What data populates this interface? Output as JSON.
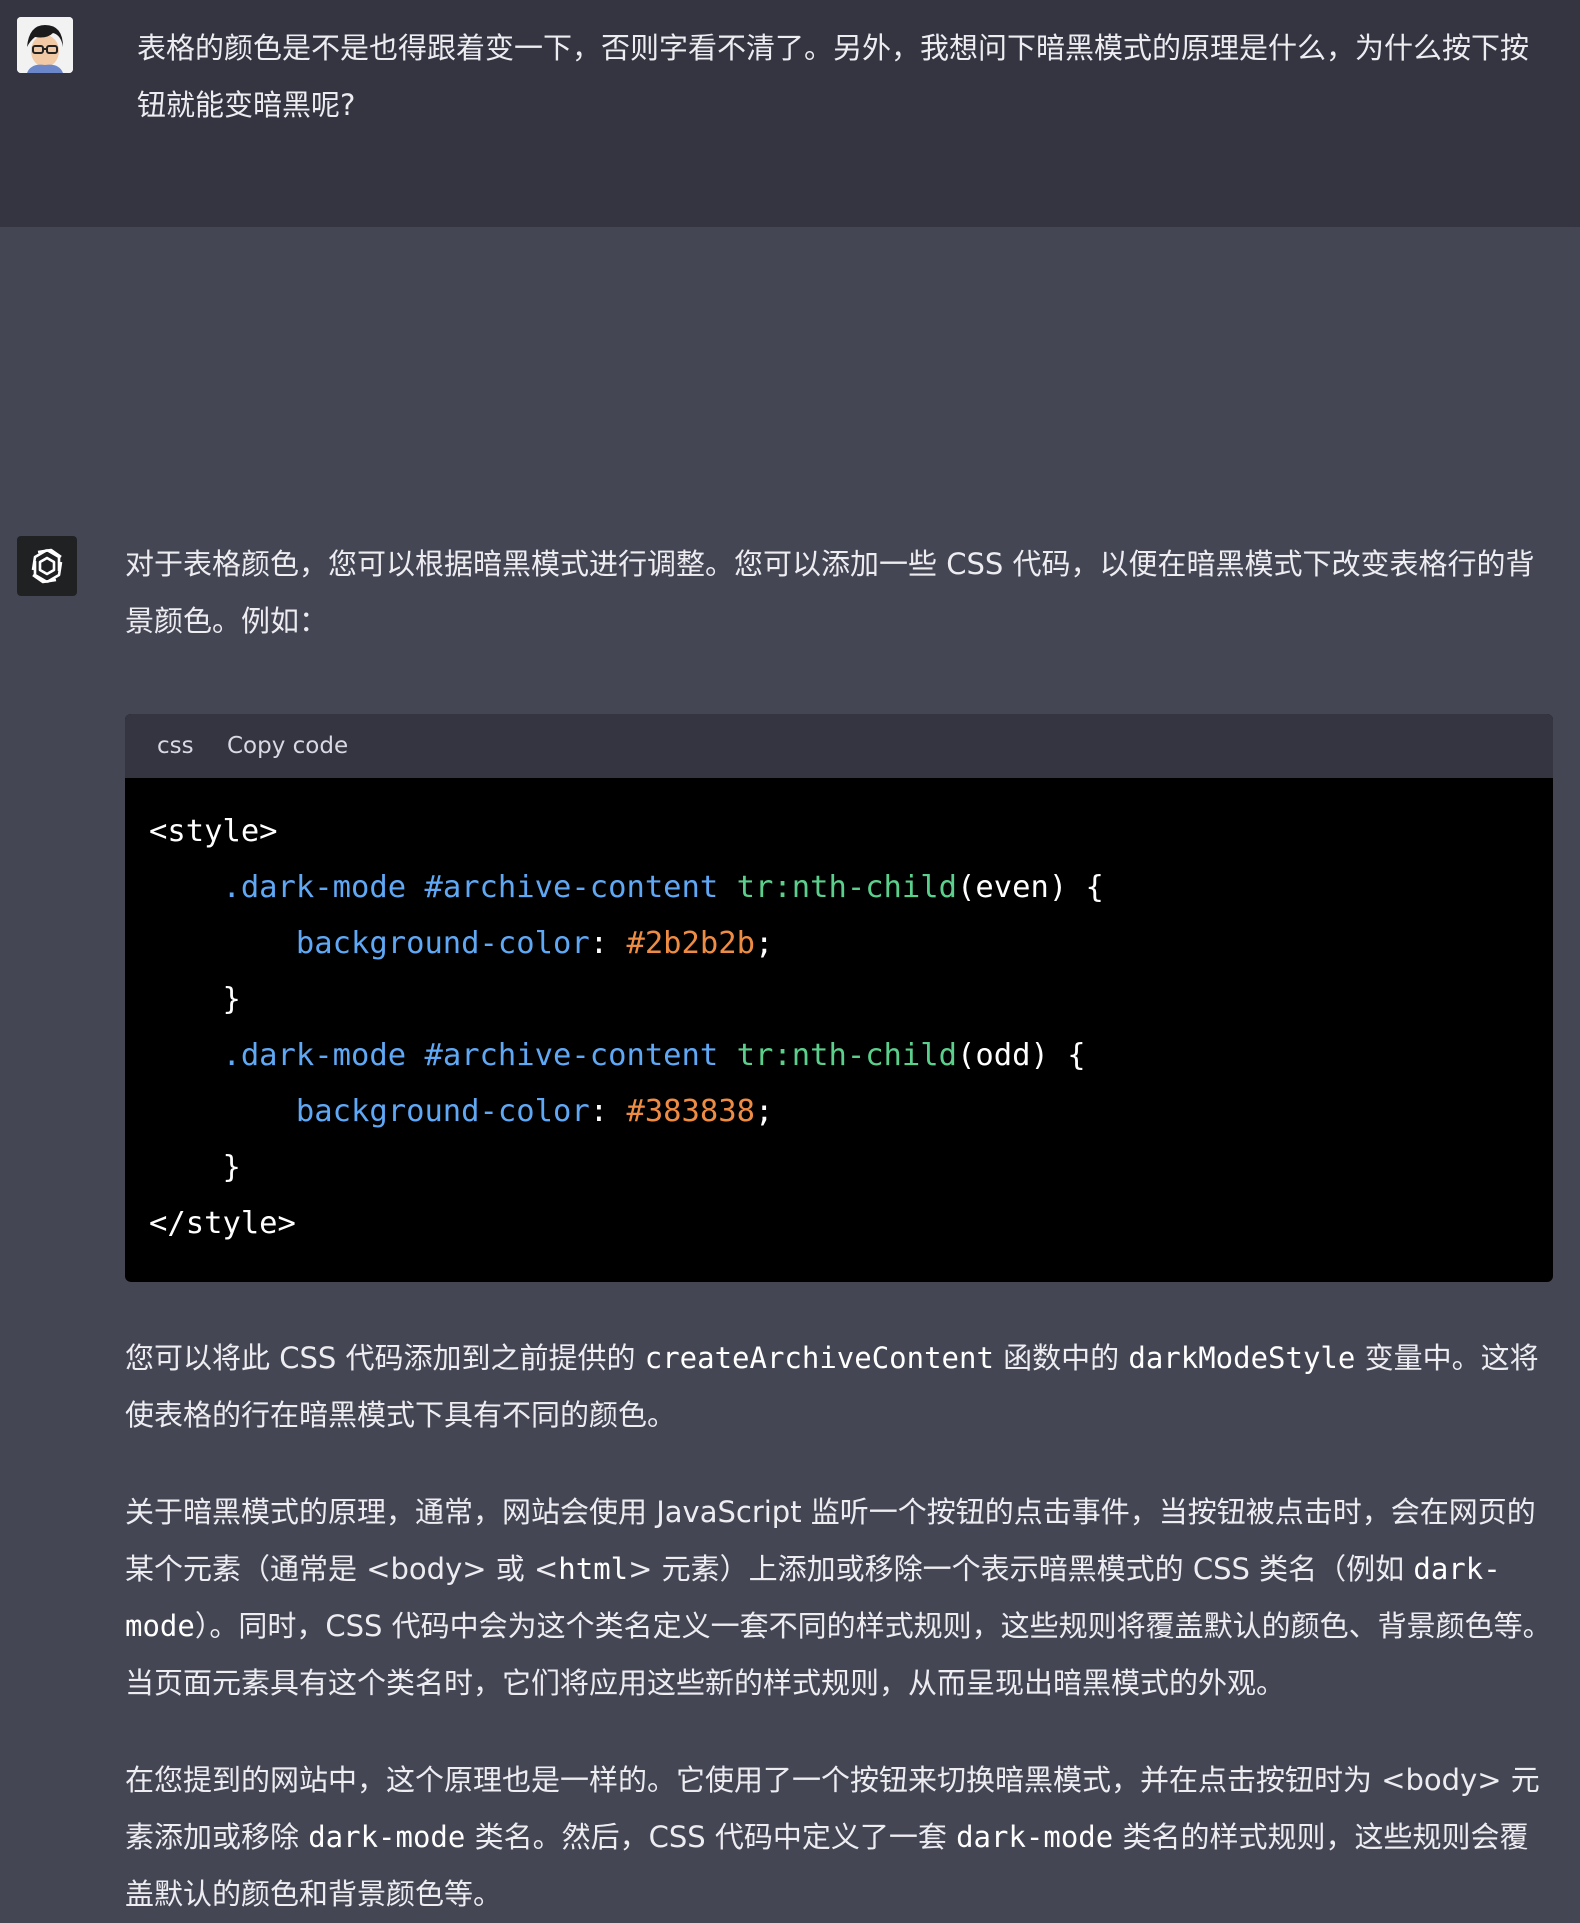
{
  "user_turn": {
    "message": "表格的颜色是不是也得跟着变一下，否则字看不清了。另外，我想问下暗黑模式的原理是什么，为什么按下按钮就能变暗黑呢?"
  },
  "assistant_turn": {
    "intro": "对于表格颜色，您可以根据暗黑模式进行调整。您可以添加一些 CSS 代码，以便在暗黑模式下改变表格行的背景颜色。例如：",
    "code_block": {
      "language": "css",
      "copy_label": "Copy code",
      "lines": {
        "l1": "<style>",
        "l2": {
          "indent": "    ",
          "class_selector": ".dark-mode",
          "id_selector": "#archive-content",
          "pseudo": "tr:nth-child",
          "arg": "(even) {"
        },
        "l3": {
          "indent": "        ",
          "property": "background-color",
          "colon": ": ",
          "value": "#2b2b2b",
          "semicolon": ";"
        },
        "l4": "    }",
        "l5": {
          "indent": "    ",
          "class_selector": ".dark-mode",
          "id_selector": "#archive-content",
          "pseudo": "tr:nth-child",
          "arg": "(odd) {"
        },
        "l6": {
          "indent": "        ",
          "property": "background-color",
          "colon": ": ",
          "value": "#383838",
          "semicolon": ";"
        },
        "l7": "    }",
        "l8": "</style>"
      }
    },
    "para1": {
      "t1": "您可以将此 CSS 代码添加到之前提供的 ",
      "c1": "createArchiveContent",
      "t2": " 函数中的 ",
      "c2": "darkModeStyle",
      "t3": " 变量中。这将使表格的行在暗黑模式下具有不同的颜色。"
    },
    "para2": {
      "t1": "关于暗黑模式的原理，通常，网站会使用 JavaScript 监听一个按钮的点击事件，当按钮被点击时，会在网页的某个元素（通常是 <body> 或 <",
      "c1": "html",
      "t2": "> 元素）上添加或移除一个表示暗黑模式的 CSS 类名（例如 ",
      "c2": "dark-mode",
      "t3": "）。同时，CSS 代码中会为这个类名定义一套不同的样式规则，这些规则将覆盖默认的颜色、背景颜色等。当页面元素具有这个类名时，它们将应用这些新的样式规则，从而呈现出暗黑模式的外观。"
    },
    "para3": {
      "t1": "在您提到的网站中，这个原理也是一样的。它使用了一个按钮来切换暗黑模式，并在点击按钮时为 <body> 元素添加或移除 ",
      "c1": "dark-mode",
      "t2": " 类名。然后，CSS 代码中定义了一套 ",
      "c2": "dark-mode",
      "t3": " 类名的样式规则，这些规则会覆盖默认的颜色和背景颜色等。"
    }
  },
  "colors": {
    "user_bg": "#343541",
    "assistant_bg": "#444654",
    "code_bg": "#000000",
    "code_header_bg": "#343541",
    "selector": "#5fa8f5",
    "element": "#5bd08d",
    "value": "#ef8c44"
  },
  "icons": {
    "user_avatar": "user-avatar-icon",
    "assistant_avatar": "openai-logo-icon"
  }
}
